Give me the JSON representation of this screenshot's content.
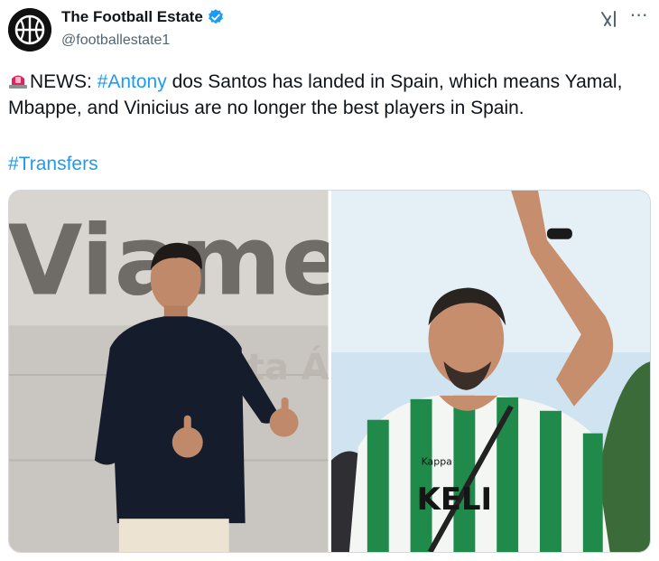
{
  "author": {
    "display_name": "The Football Estate",
    "handle": "@footballestate1",
    "verified": true
  },
  "tweet": {
    "news_prefix": "NEWS: ",
    "hashtag_antony": "#Antony",
    "text_rest": " dos Santos has landed in Spain, which means Yamal, Mbappe, and Vinicius are no longer the best players in Spain.",
    "hashtag_transfers": "#Transfers"
  },
  "media": {
    "left_photo": {
      "wall_sign_top": "Viamed",
      "wall_sign_bottom": "Santa Ángela"
    },
    "right_photo": {
      "shirt_sponsor": "KELI",
      "shirt_brand": "Kappa"
    }
  },
  "icons": {
    "avatar": "basketball-logo",
    "verified": "verified-badge-icon",
    "grok": "grok-icon",
    "more": "more-icon",
    "siren": "siren-emoji-icon"
  },
  "colors": {
    "accent": "#1d9bf0",
    "text": "#0f1419",
    "muted": "#536471"
  }
}
